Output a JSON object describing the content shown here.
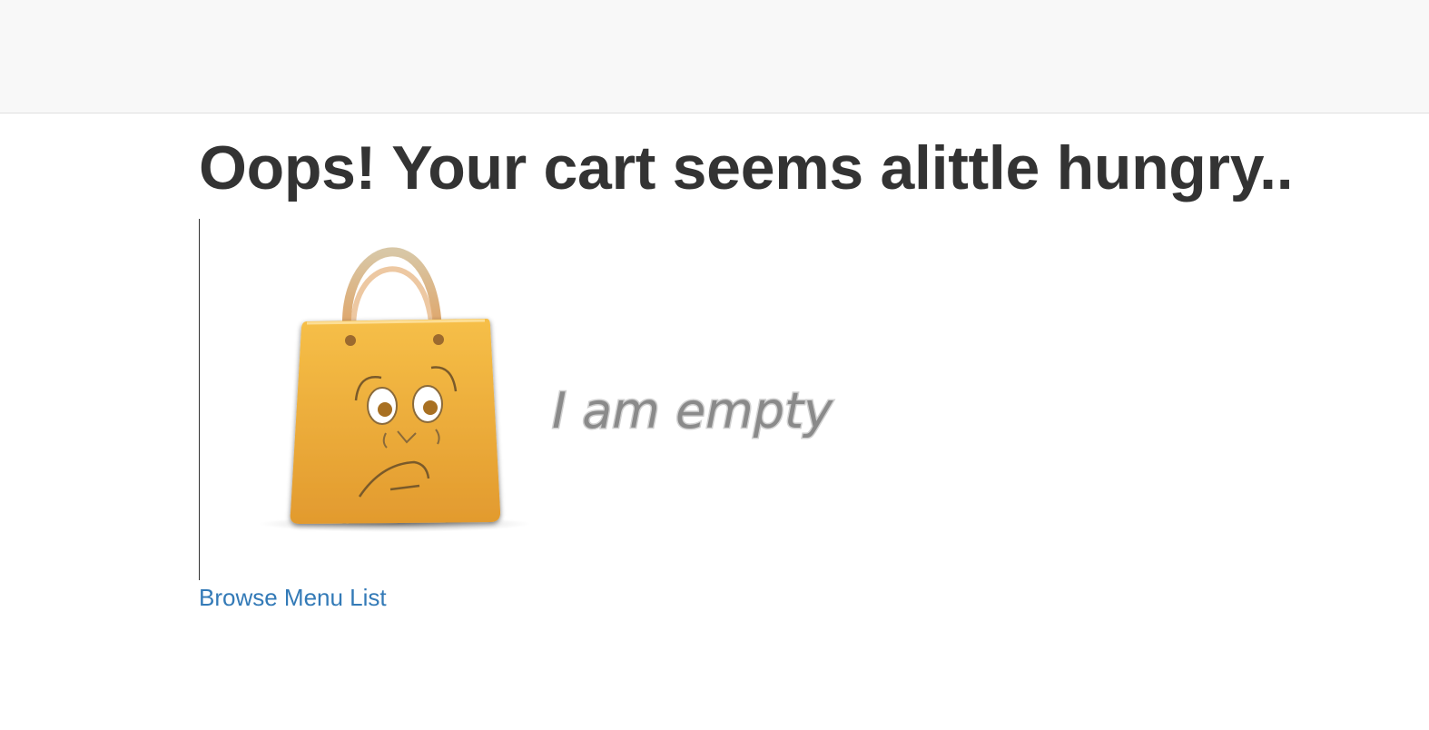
{
  "header": {},
  "main": {
    "title": "Oops! Your cart seems alittle hungry..",
    "illustration": {
      "icon": "empty-shopping-bag",
      "caption": "I am empty"
    },
    "browse_link": "Browse Menu List"
  },
  "colors": {
    "navbar_bg": "#f8f8f8",
    "title": "#333333",
    "link": "#337ab7",
    "bag": "#f0b03a"
  }
}
